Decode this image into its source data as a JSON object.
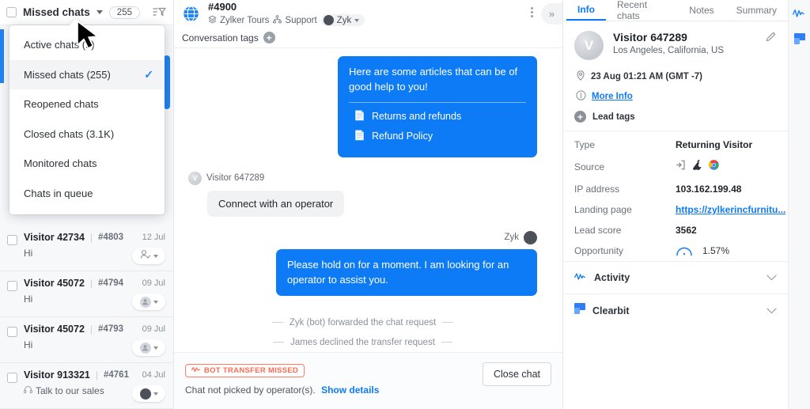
{
  "chat_list": {
    "toolbar": {
      "filter_label": "Missed chats",
      "count": "255",
      "filter_icon": "filter-sort-icon",
      "more_icon": "more-vertical-icon",
      "caret_icon": "chevron-down-icon"
    },
    "dropdown": {
      "items": [
        {
          "label": "Active chats (9)",
          "selected": false
        },
        {
          "label": "Missed chats (255)",
          "selected": true
        },
        {
          "label": "Reopened chats",
          "selected": false
        },
        {
          "label": "Closed chats (3.1K)",
          "selected": false
        },
        {
          "label": "Monitored chats",
          "selected": false
        },
        {
          "label": "Chats in queue",
          "selected": false
        }
      ],
      "check_glyph": "✓"
    },
    "rows": [
      {
        "name": "Visitor 42734",
        "id": "#4803",
        "date": "12 Jul",
        "message": "Hi",
        "msg_icon": "",
        "avatar_type": "agent-add"
      },
      {
        "name": "Visitor 45072",
        "id": "#4794",
        "date": "09 Jul",
        "message": "Hi",
        "msg_icon": "",
        "avatar_type": "person"
      },
      {
        "name": "Visitor 45072",
        "id": "#4793",
        "date": "09 Jul",
        "message": "Hi",
        "msg_icon": "",
        "avatar_type": "person"
      },
      {
        "name": "Visitor 913321",
        "id": "#4761",
        "date": "04 Jul",
        "message": "Talk to our sales",
        "msg_icon": "headset-icon",
        "avatar_type": "bot"
      }
    ]
  },
  "conversation": {
    "header": {
      "id": "#4900",
      "globe_icon": "globe-icon",
      "department": "Zylker Tours",
      "department_icon": "layers-icon",
      "team": "Support",
      "team_icon": "sitemap-icon",
      "bot": "Zyk",
      "more_icon": "more-vertical-icon",
      "expand_icon": "chevron-double-right-icon"
    },
    "tags": {
      "label": "Conversation tags",
      "add_icon": "plus-circle-icon"
    },
    "messages": [
      {
        "type": "bot-articles",
        "text": "Here are some articles that can be of good help to you!",
        "articles": [
          {
            "title": "Returns and refunds",
            "icon": "document-icon"
          },
          {
            "title": "Refund Policy",
            "icon": "document-icon"
          }
        ]
      },
      {
        "type": "visitor",
        "sender": "Visitor 647289",
        "avatar_letter": "V",
        "text": "Connect with an operator"
      },
      {
        "type": "outgoing",
        "sender": "Zyk",
        "text": "Please hold on for a moment. I am looking for an operator to assist you."
      },
      {
        "type": "system",
        "text": "Zyk (bot) forwarded the chat request"
      },
      {
        "type": "system",
        "text": "James declined the transfer request"
      }
    ],
    "footer": {
      "badge": "BOT TRANSFER MISSED",
      "badge_icon": "activity-wave-icon",
      "note": "Chat not picked by operator(s).",
      "link": "Show details",
      "close_button": "Close chat"
    }
  },
  "right_panel": {
    "tabs": [
      {
        "label": "Info",
        "active": true
      },
      {
        "label": "Recent chats",
        "active": false
      },
      {
        "label": "Notes",
        "active": false
      },
      {
        "label": "Summary",
        "active": false
      }
    ],
    "visitor": {
      "name": "Visitor 647289",
      "avatar_letter": "V",
      "location": "Los Angeles, California, US",
      "edit_icon": "pencil-icon",
      "time": "23 Aug 01:21 AM  (GMT -7)",
      "time_icon": "clock-pin-icon",
      "more_info": "More Info",
      "more_info_icon": "info-circle-icon",
      "lead_tags": "Lead tags",
      "lead_tags_icon": "plus-circle-icon"
    },
    "details": [
      {
        "key": "Type",
        "value": "Returning Visitor",
        "kind": "text"
      },
      {
        "key": "Source",
        "value": "",
        "kind": "icons",
        "icons": [
          "direct-visit-icon",
          "apple-icon",
          "chrome-icon"
        ]
      },
      {
        "key": "IP address",
        "value": "103.162.199.48",
        "kind": "text"
      },
      {
        "key": "Landing page",
        "value": "https://zylkerincfurnitu...",
        "kind": "link"
      },
      {
        "key": "Lead score",
        "value": "3562",
        "kind": "text"
      },
      {
        "key": "Opportunity",
        "value": "1.57%",
        "kind": "gauge"
      }
    ],
    "sections": [
      {
        "label": "Activity",
        "icon": "activity-wave-icon",
        "chevron": "chevron-down-icon"
      },
      {
        "label": "Clearbit",
        "icon": "clearbit-icon",
        "chevron": "chevron-down-icon"
      }
    ],
    "rail": [
      {
        "icon": "activity-wave-icon"
      },
      {
        "icon": "clearbit-icon"
      }
    ]
  },
  "colors": {
    "accent": "#0d7bf5",
    "missed": "#ff6a50",
    "panel_bg": "#f7f8fa"
  }
}
